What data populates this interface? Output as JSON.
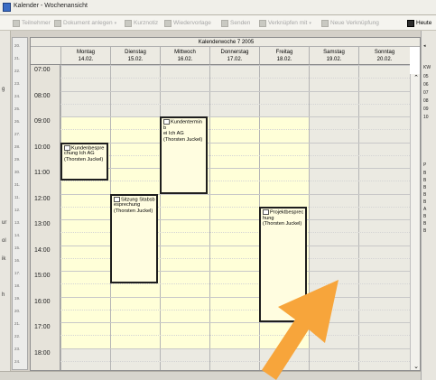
{
  "window": {
    "title": "Kalender - Wochenansicht"
  },
  "toolbar": {
    "teilnehmer": "Teilnehmer",
    "dokument": "Dokument anlegen",
    "kurznotiz": "Kurznotiz",
    "wiedervorlage": "Wiedervorlage",
    "senden": "Senden",
    "verknuepfen": "Verknüpfen mit",
    "neue_verknuepfung": "Neue Verknüpfung",
    "heute": "Heute"
  },
  "calendar": {
    "week_label": "Kalenderwoche 7  2005",
    "days": [
      {
        "name": "Montag",
        "date": "14.02."
      },
      {
        "name": "Dienstag",
        "date": "15.02."
      },
      {
        "name": "Mittwoch",
        "date": "16.02."
      },
      {
        "name": "Donnerstag",
        "date": "17.02."
      },
      {
        "name": "Freitag",
        "date": "18.02."
      },
      {
        "name": "Samstag",
        "date": "19.02."
      },
      {
        "name": "Sonntag",
        "date": "20.02."
      }
    ],
    "hours": [
      "07:00",
      "08:00",
      "09:00",
      "10:00",
      "11:00",
      "12:00",
      "13:00",
      "14:00",
      "15:00",
      "16:00",
      "17:00",
      "18:00"
    ],
    "appointments": [
      {
        "day": "Montag",
        "start": "10:00",
        "end": "11:30",
        "text": "Kundenbesprechung Ich AG (Thorsten Juckel)",
        "t1": "Kundenbespre",
        "t2": "chung Ich AG",
        "t3": "(Thorsten Juckel)"
      },
      {
        "day": "Dienstag",
        "start": "12:00",
        "end": "15:30",
        "text": "Sitzung Stabsbesprechung (Thorsten Juckel)",
        "t1": "Sitzung Stabsb",
        "t2": "esprechung",
        "t3": "(Thorsten Juckel)"
      },
      {
        "day": "Mittwoch",
        "start": "09:00",
        "end": "12:00",
        "text": "Kundentermin bei Ich AG (Thorsten Juckel)",
        "t1": "Kundentermin b",
        "t2": "ei Ich AG",
        "t3": "(Thorsten Juckel)"
      },
      {
        "day": "Freitag",
        "start": "12:30",
        "end": "17:00",
        "text": "Projektbesprechung (Thorsten Juckel)",
        "t1": "Projektbesprec",
        "t2": "hung",
        "t3": "(Thorsten Juckel)"
      }
    ]
  },
  "colors": {
    "work_hours": "#ffffd8",
    "off_hours": "#ebeae2",
    "appointment_border": "#1e1e1e",
    "cursor_arrow": "#f7a53b"
  },
  "ruler": {
    "labels": [
      "20.",
      "21.",
      "22.",
      "23.",
      "24.",
      "25.",
      "26.",
      "27.",
      "28.",
      "29.",
      "30.",
      "31.",
      "11.",
      "12.",
      "13.",
      "14.",
      "15.",
      "16.",
      "17.",
      "18.",
      "19.",
      "20.",
      "21.",
      "22.",
      "23.",
      "24."
    ]
  },
  "right_panel": {
    "kw": "KW",
    "weeks": [
      "05",
      "06",
      "07",
      "08",
      "09",
      "10"
    ],
    "list_header": "P",
    "list_items": [
      "B",
      "B",
      "B",
      "B",
      "B",
      "A",
      "B",
      "B",
      "B"
    ]
  },
  "left_marks": [
    "g",
    "ur",
    "ol",
    "ik",
    "h"
  ],
  "icons": {
    "cursor": "arrow-cursor-icon"
  }
}
